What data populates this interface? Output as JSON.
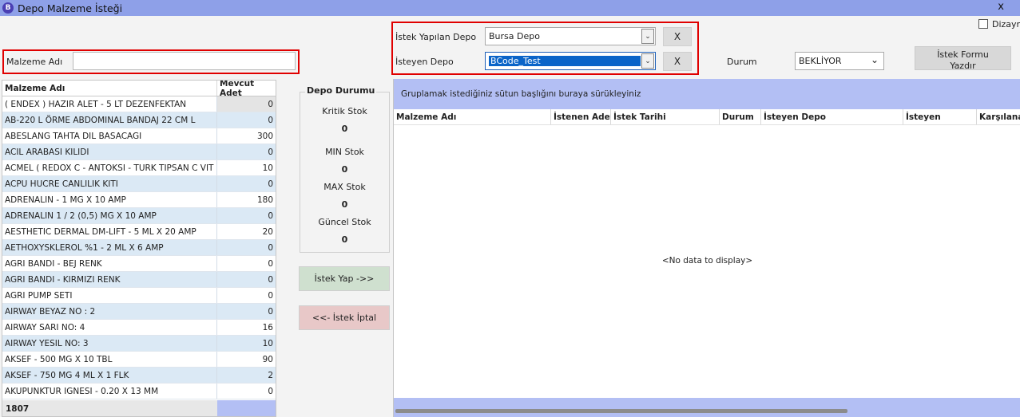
{
  "window": {
    "title": "Depo Malzeme İsteği",
    "app_icon": "B",
    "close": "x"
  },
  "filter": {
    "malzeme_label": "Malzeme Adı",
    "malzeme_value": ""
  },
  "request": {
    "istek_yapilan_label": "İstek Yapılan Depo",
    "istek_yapilan_value": "Bursa Depo",
    "isteyen_label": "İsteyen Depo",
    "isteyen_value": "BCode_Test",
    "clear_label": "X"
  },
  "status": {
    "durum_label": "Durum",
    "durum_value": "BEKLİYOR"
  },
  "print_button": {
    "line1": "İstek Formu",
    "line2": "Yazdır"
  },
  "design_checkbox": {
    "label": "Dizayn",
    "checked": false
  },
  "left_grid": {
    "columns": [
      "Malzeme Adı",
      "Mevcut Adet"
    ],
    "rows": [
      {
        "name": "( ENDEX ) HAZIR ALET - 5 LT DEZENFEKTAN",
        "qty": "0"
      },
      {
        "name": "AB-220 L  ÖRME ABDOMINAL BANDAJ 22 CM L",
        "qty": "0"
      },
      {
        "name": "ABESLANG TAHTA DIL BASACAGI",
        "qty": "300"
      },
      {
        "name": "ACIL ARABASI KILIDI",
        "qty": "0"
      },
      {
        "name": "ACMEL ( REDOX C - ANTOKSI -  TURK TIPSAN C VIT",
        "qty": "10"
      },
      {
        "name": "ACPU HUCRE CANLILIK KITI",
        "qty": "0"
      },
      {
        "name": "ADRENALIN - 1 MG X 10 AMP",
        "qty": "180"
      },
      {
        "name": "ADRENALIN 1 / 2 (0,5) MG X 10 AMP",
        "qty": "0"
      },
      {
        "name": "AESTHETIC DERMAL DM-LIFT - 5 ML X 20 AMP",
        "qty": "20"
      },
      {
        "name": "AETHOXYSKLEROL %1 - 2 ML X 6 AMP",
        "qty": "0"
      },
      {
        "name": "AGRI BANDI - BEJ RENK",
        "qty": "0"
      },
      {
        "name": "AGRI BANDI - KIRMIZI RENK",
        "qty": "0"
      },
      {
        "name": "AGRI PUMP SETI",
        "qty": "0"
      },
      {
        "name": "AIRWAY BEYAZ NO : 2",
        "qty": "0"
      },
      {
        "name": "AIRWAY SARI NO: 4",
        "qty": "16"
      },
      {
        "name": "AIRWAY YESIL NO: 3",
        "qty": "10"
      },
      {
        "name": "AKSEF - 500 MG X  10 TBL",
        "qty": "90"
      },
      {
        "name": "AKSEF - 750 MG 4 ML X 1 FLK",
        "qty": "2"
      },
      {
        "name": "AKUPUNKTUR IGNESI - 0.20 X 13 MM",
        "qty": "0"
      }
    ],
    "footer_count": "1807"
  },
  "depo_durumu": {
    "title": "Depo Durumu",
    "kritik_label": "Kritik Stok",
    "kritik_value": "0",
    "min_label": "MIN Stok",
    "min_value": "0",
    "max_label": "MAX Stok",
    "max_value": "0",
    "guncel_label": "Güncel Stok",
    "guncel_value": "0"
  },
  "actions": {
    "istek_yap": "İstek Yap ->>",
    "istek_iptal": "<<- İstek İptal"
  },
  "right_grid": {
    "group_hint": "Gruplamak istediğiniz sütun başlığını buraya sürükleyiniz",
    "columns": [
      "Malzeme Adı",
      "İstenen Adet",
      "İstek Tarihi",
      "Durum",
      "İsteyen Depo",
      "İsteyen",
      "Karşılanan"
    ],
    "empty_text": "<No data to display>"
  },
  "colors": {
    "titlebar": "#8ea0e8",
    "highlight": "#e00000",
    "group_panel": "#b3bff4",
    "selection": "#0a64c8"
  }
}
